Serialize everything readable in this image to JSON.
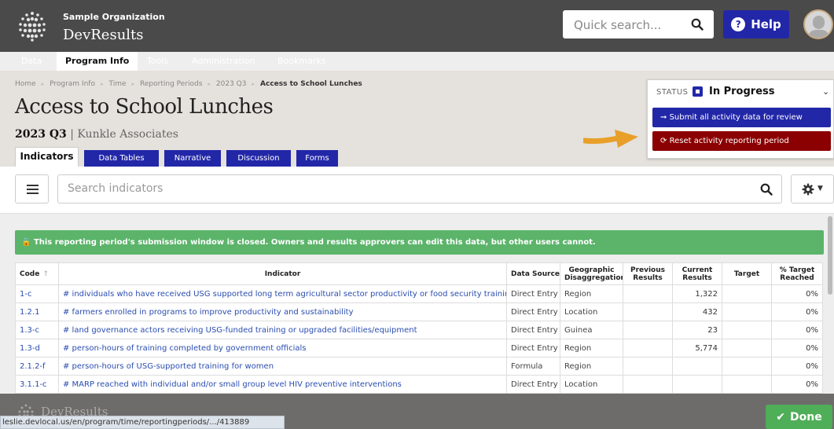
{
  "header": {
    "org_name": "Sample Organization",
    "brand": "DevResults",
    "search_placeholder": "Quick search...",
    "help_label": "Help"
  },
  "nav": {
    "items": [
      "Data",
      "Program Info",
      "Tools",
      "Administration",
      "Bookmarks"
    ],
    "active": "Program Info"
  },
  "breadcrumb": [
    "Home",
    "Program Info",
    "Time",
    "Reporting Periods",
    "2023 Q3",
    "Access to School Lunches"
  ],
  "page": {
    "title": "Access to School Lunches",
    "period": "2023 Q3",
    "separator": "|",
    "organization": "Kunkle Associates"
  },
  "tabs": [
    "Indicators",
    "Data Tables",
    "Narrative",
    "Discussion",
    "Forms"
  ],
  "status": {
    "label": "STATUS",
    "value": "In Progress",
    "submit_label": "Submit all activity data for review",
    "reset_label": "Reset activity reporting period"
  },
  "indicator_search": {
    "placeholder": "Search indicators"
  },
  "alert": {
    "text": "This reporting period's submission window is closed. Owners and results approvers can edit this data, but other users cannot."
  },
  "table": {
    "headers": {
      "code": "Code",
      "indicator": "Indicator",
      "data_source": "Data Source",
      "geo1": "Geographic",
      "geo2": "Disaggregation",
      "prev1": "Previous",
      "prev2": "Results",
      "curr1": "Current",
      "curr2": "Results",
      "target": "Target",
      "pct1": "% Target",
      "pct2": "Reached"
    },
    "rows": [
      {
        "code": "1-c",
        "indicator": "# individuals who have received USG supported long term agricultural sector productivity or food security training",
        "source": "Direct Entry",
        "geo": "Region",
        "prev": "",
        "curr": "1,322",
        "target": "",
        "pct": "0%"
      },
      {
        "code": "1.2.1",
        "indicator": "# farmers enrolled in programs to improve productivity and sustainability",
        "source": "Direct Entry",
        "geo": "Location",
        "prev": "",
        "curr": "432",
        "target": "",
        "pct": "0%"
      },
      {
        "code": "1.3-c",
        "indicator": "# land governance actors receiving USG-funded training or upgraded facilities/equipment",
        "source": "Direct Entry",
        "geo": "Guinea",
        "prev": "",
        "curr": "23",
        "target": "",
        "pct": "0%"
      },
      {
        "code": "1.3-d",
        "indicator": "# person-hours of training completed by government officials",
        "source": "Direct Entry",
        "geo": "Region",
        "prev": "",
        "curr": "5,774",
        "target": "",
        "pct": "0%"
      },
      {
        "code": "2.1.2-f",
        "indicator": "# person-hours of USG-supported training for women",
        "source": "Formula",
        "geo": "Region",
        "prev": "",
        "curr": "",
        "target": "",
        "pct": "0%"
      },
      {
        "code": "3.1.1-c",
        "indicator": "# MARP reached with individual and/or small group level HIV preventive interventions",
        "source": "Direct Entry",
        "geo": "Location",
        "prev": "",
        "curr": "",
        "target": "",
        "pct": "0%"
      }
    ]
  },
  "footer": {
    "brand": "DevResults",
    "url": "leslie.devlocal.us/en/program/time/reportingperiods/.../413889",
    "done_label": "Done"
  },
  "colors": {
    "header_bg": "#4b4a4a",
    "primary_blue": "#2227a8",
    "danger_red": "#8b0000",
    "success_green": "#5bb46a",
    "arrow_orange": "#e8a02a"
  }
}
